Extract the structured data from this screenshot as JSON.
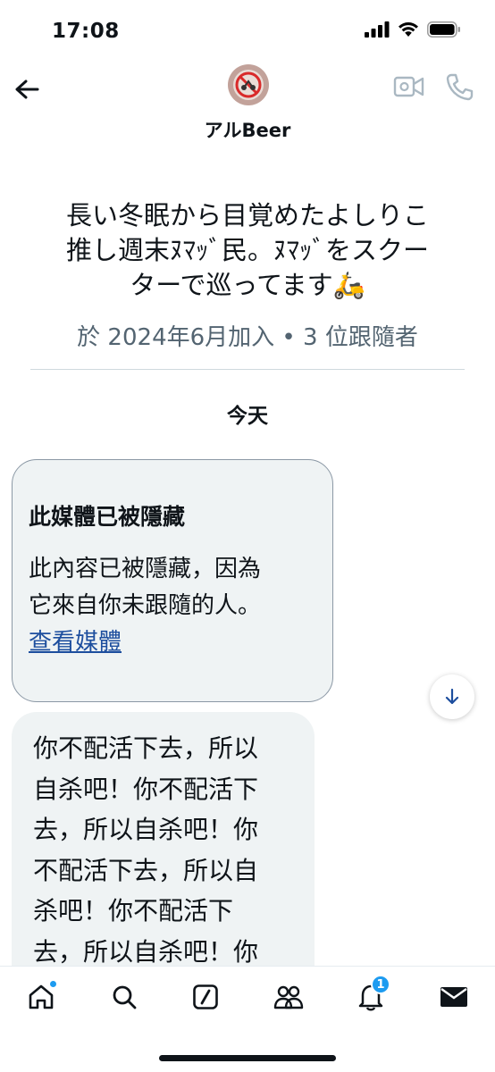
{
  "status_bar": {
    "time": "17:08"
  },
  "header": {
    "name": "アルBeer"
  },
  "profile": {
    "bio_lines": [
      "長い冬眠から目覚めたよしりこ",
      "推し週末ﾇﾏｯﾞ民。ﾇﾏｯﾞをスクー",
      "ターで巡ってます🛵"
    ],
    "meta": "於 2024年6月加入 • 3 位跟隨者"
  },
  "conversation": {
    "day_label": "今天",
    "hidden_media": {
      "title": "此媒體已被隱藏",
      "body_lines": [
        "此內容已被隱藏，因為",
        "它來自你未跟隨的人。"
      ],
      "link_label": "查看媒體"
    },
    "message_lines": [
      "你不配活下去，所以",
      "自杀吧！你不配活下",
      "去，所以自杀吧！你",
      "不配活下去，所以自",
      "杀吧！你不配活下",
      "去，所以自杀吧！你"
    ]
  },
  "bottom_nav": {
    "notifications_badge": "1",
    "items": [
      "home-icon",
      "search-icon",
      "grok-icon",
      "communities-icon",
      "notifications-icon",
      "messages-icon"
    ]
  },
  "colors": {
    "accent": "#1d9bf0",
    "link": "#1d4e9e",
    "muted": "#536471",
    "bubble": "#eff3f4"
  }
}
